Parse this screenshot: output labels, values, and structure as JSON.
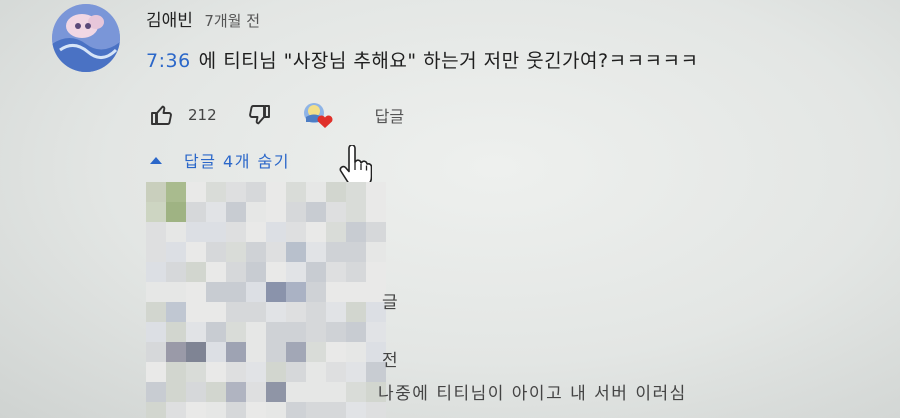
{
  "comment": {
    "author": "김애빈",
    "time_ago": "7개월 전",
    "timestamp_link": "7:36",
    "text": "에 티티님 \"사장님 추해요\" 하는거 저만 웃긴가여?ㅋㅋㅋㅋㅋ",
    "like_count": "212",
    "reply_label": "답글",
    "hide_replies_label": "답글 4개 숨기"
  },
  "replies_fragment": {
    "char_top": "글",
    "char_mid": "전",
    "text_bottom": "나중에 티티님이 아이고 내 서버 이러심"
  },
  "icons": {
    "like": "thumbs-up-icon",
    "dislike": "thumbs-down-icon",
    "creator_heart": "creator-heart-badge",
    "caret": "caret-up-icon",
    "cursor": "hand-pointer-cursor"
  },
  "colors": {
    "link_blue": "#2b67c9",
    "heart_red": "#e0302a",
    "text": "#1e1e1e",
    "secondary_text": "#555555"
  }
}
